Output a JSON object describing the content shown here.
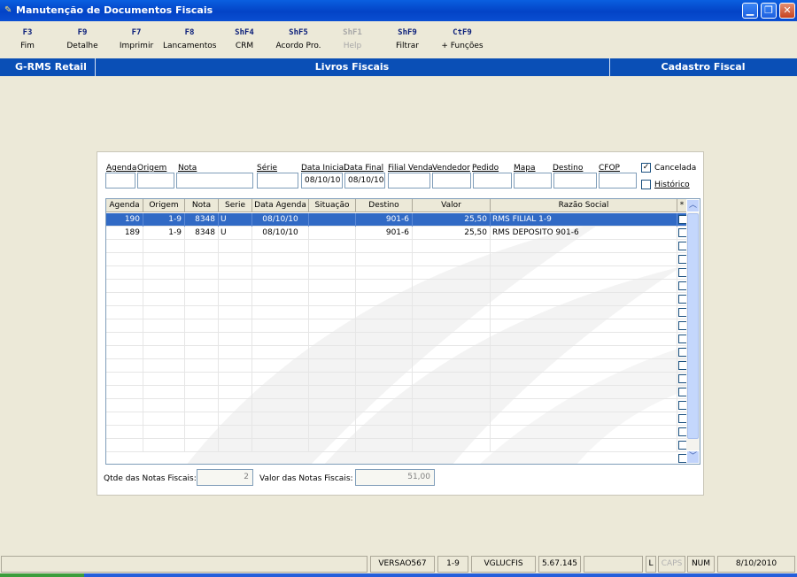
{
  "window": {
    "title": "Manutenção de Documentos Fiscais"
  },
  "function_keys": [
    {
      "key": "F3",
      "label": "Fim",
      "enabled": true
    },
    {
      "key": "F9",
      "label": "Detalhe",
      "enabled": true
    },
    {
      "key": "F7",
      "label": "Imprimir",
      "enabled": true
    },
    {
      "key": "F8",
      "label": "Lancamentos",
      "enabled": true
    },
    {
      "key": "ShF4",
      "label": "CRM",
      "enabled": true
    },
    {
      "key": "ShF5",
      "label": "Acordo Pro.",
      "enabled": true
    },
    {
      "key": "ShF1",
      "label": "Help",
      "enabled": false
    },
    {
      "key": "ShF9",
      "label": "Filtrar",
      "enabled": true
    },
    {
      "key": "CtF9",
      "label": "+ Funções",
      "enabled": true
    }
  ],
  "header_bar": {
    "left": "G-RMS Retail",
    "center": "Livros Fiscais",
    "right": "Cadastro Fiscal"
  },
  "filters": {
    "agenda": {
      "label": "Agenda",
      "value": ""
    },
    "origem": {
      "label": "Origem",
      "value": ""
    },
    "nota": {
      "label": "Nota",
      "value": ""
    },
    "serie": {
      "label": "Série",
      "value": ""
    },
    "data_inicial": {
      "label": "Data Inicial",
      "value": "08/10/10"
    },
    "data_final": {
      "label": "Data Final",
      "value": "08/10/10"
    },
    "filial_venda": {
      "label": "Filial Venda",
      "value": ""
    },
    "vendedor": {
      "label": "Vendedor",
      "value": ""
    },
    "pedido": {
      "label": "Pedido",
      "value": ""
    },
    "mapa": {
      "label": "Mapa",
      "value": ""
    },
    "destino": {
      "label": "Destino",
      "value": ""
    },
    "cfop": {
      "label": "CFOP",
      "value": ""
    },
    "cancelada": {
      "label": "Cancelada",
      "checked": true
    },
    "historico": {
      "label": "Histórico",
      "checked": false
    }
  },
  "table": {
    "columns": [
      "Agenda",
      "Origem",
      "Nota",
      "Serie",
      "Data Agenda",
      "Situação",
      "Destino",
      "Valor",
      "Razão Social",
      "*"
    ],
    "rows": [
      {
        "agenda": "190",
        "origem": "1-9",
        "nota": "8348",
        "serie": "U",
        "data_agenda": "08/10/10",
        "situacao": "",
        "destino": "901-6",
        "valor": "25,50",
        "razao_social": "RMS FILIAL 1-9",
        "selected": true
      },
      {
        "agenda": "189",
        "origem": "1-9",
        "nota": "8348",
        "serie": "U",
        "data_agenda": "08/10/10",
        "situacao": "",
        "destino": "901-6",
        "valor": "25,50",
        "razao_social": "RMS DEPOSITO 901-6",
        "selected": false
      }
    ]
  },
  "summary": {
    "qtde_label": "Qtde das Notas Fiscais:",
    "qtde_value": "2",
    "valor_label": "Valor  das Notas Fiscais:",
    "valor_value": "51,00"
  },
  "status_bar": {
    "version": "VERSAO567",
    "filial": "1-9",
    "program": "VGLUCFIS",
    "build": "5.67.145",
    "l": "L",
    "caps": "CAPS",
    "num": "NUM",
    "date": "8/10/2010"
  },
  "colors": {
    "title_bar": "#0A5FE0",
    "header_bar": "#0A4FB6",
    "selection": "#316AC5",
    "function_key_text": "#0b1f7a"
  }
}
